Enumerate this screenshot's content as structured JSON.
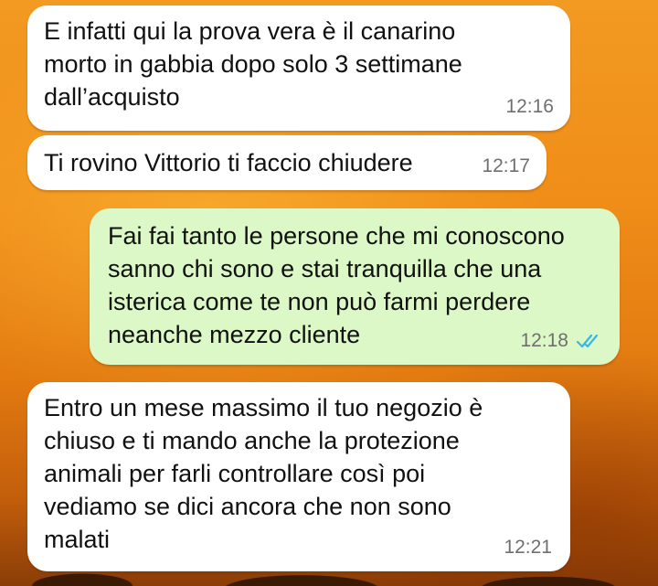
{
  "chat": {
    "messages": [
      {
        "direction": "incoming",
        "text": "E infatti qui la prova vera è il canarino\nmorto in gabbia dopo solo 3 settimane\ndall’acquisto",
        "time": "12:16"
      },
      {
        "direction": "incoming",
        "text": "Ti rovino Vittorio ti faccio chiudere",
        "time": "12:17"
      },
      {
        "direction": "outgoing",
        "text": "Fai fai tanto le persone che mi conoscono\nsanno chi sono e stai tranquilla che una\nisterica come te non può farmi perdere\nneanche mezzo cliente",
        "time": "12:18",
        "status": "read",
        "status_icon": "double-check-icon"
      },
      {
        "direction": "incoming",
        "text": "Entro un mese massimo il tuo negozio è\nchiuso e ti mando anche la protezione\nanimali per farli controllare così poi\nvediamo se dici ancora che non sono\nmalati",
        "time": "12:21"
      }
    ]
  },
  "colors": {
    "incoming_bubble": "#ffffff",
    "outgoing_bubble": "#dcf8c6",
    "read_ticks": "#34b7f1",
    "wallpaper": "#ef8d18"
  }
}
